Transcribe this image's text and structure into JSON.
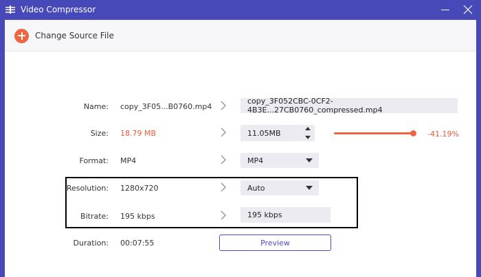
{
  "window": {
    "title": "Video Compressor"
  },
  "toolbar": {
    "change_source_label": "Change Source File"
  },
  "fields": {
    "name": {
      "label": "Name:",
      "source": "copy_3F05...B0760.mp4",
      "output": "copy_3F052CBC-0CF2-4B3E...27CB0760_compressed.mp4"
    },
    "size": {
      "label": "Size:",
      "source": "18.79 MB",
      "output": "11.05MB",
      "percent": "-41.19%",
      "slider_fraction": 0.96
    },
    "format": {
      "label": "Format:",
      "source": "MP4",
      "output": "MP4"
    },
    "resolution": {
      "label": "Resolution:",
      "source": "1280x720",
      "output": "Auto"
    },
    "bitrate": {
      "label": "Bitrate:",
      "source": "195 kbps",
      "output": "195 kbps"
    },
    "duration": {
      "label": "Duration:",
      "source": "00:07:55"
    }
  },
  "preview": {
    "label": "Preview"
  },
  "colors": {
    "accent": "#f06541",
    "titlebar": "#4849b8",
    "preview": "#4c4cc4"
  }
}
